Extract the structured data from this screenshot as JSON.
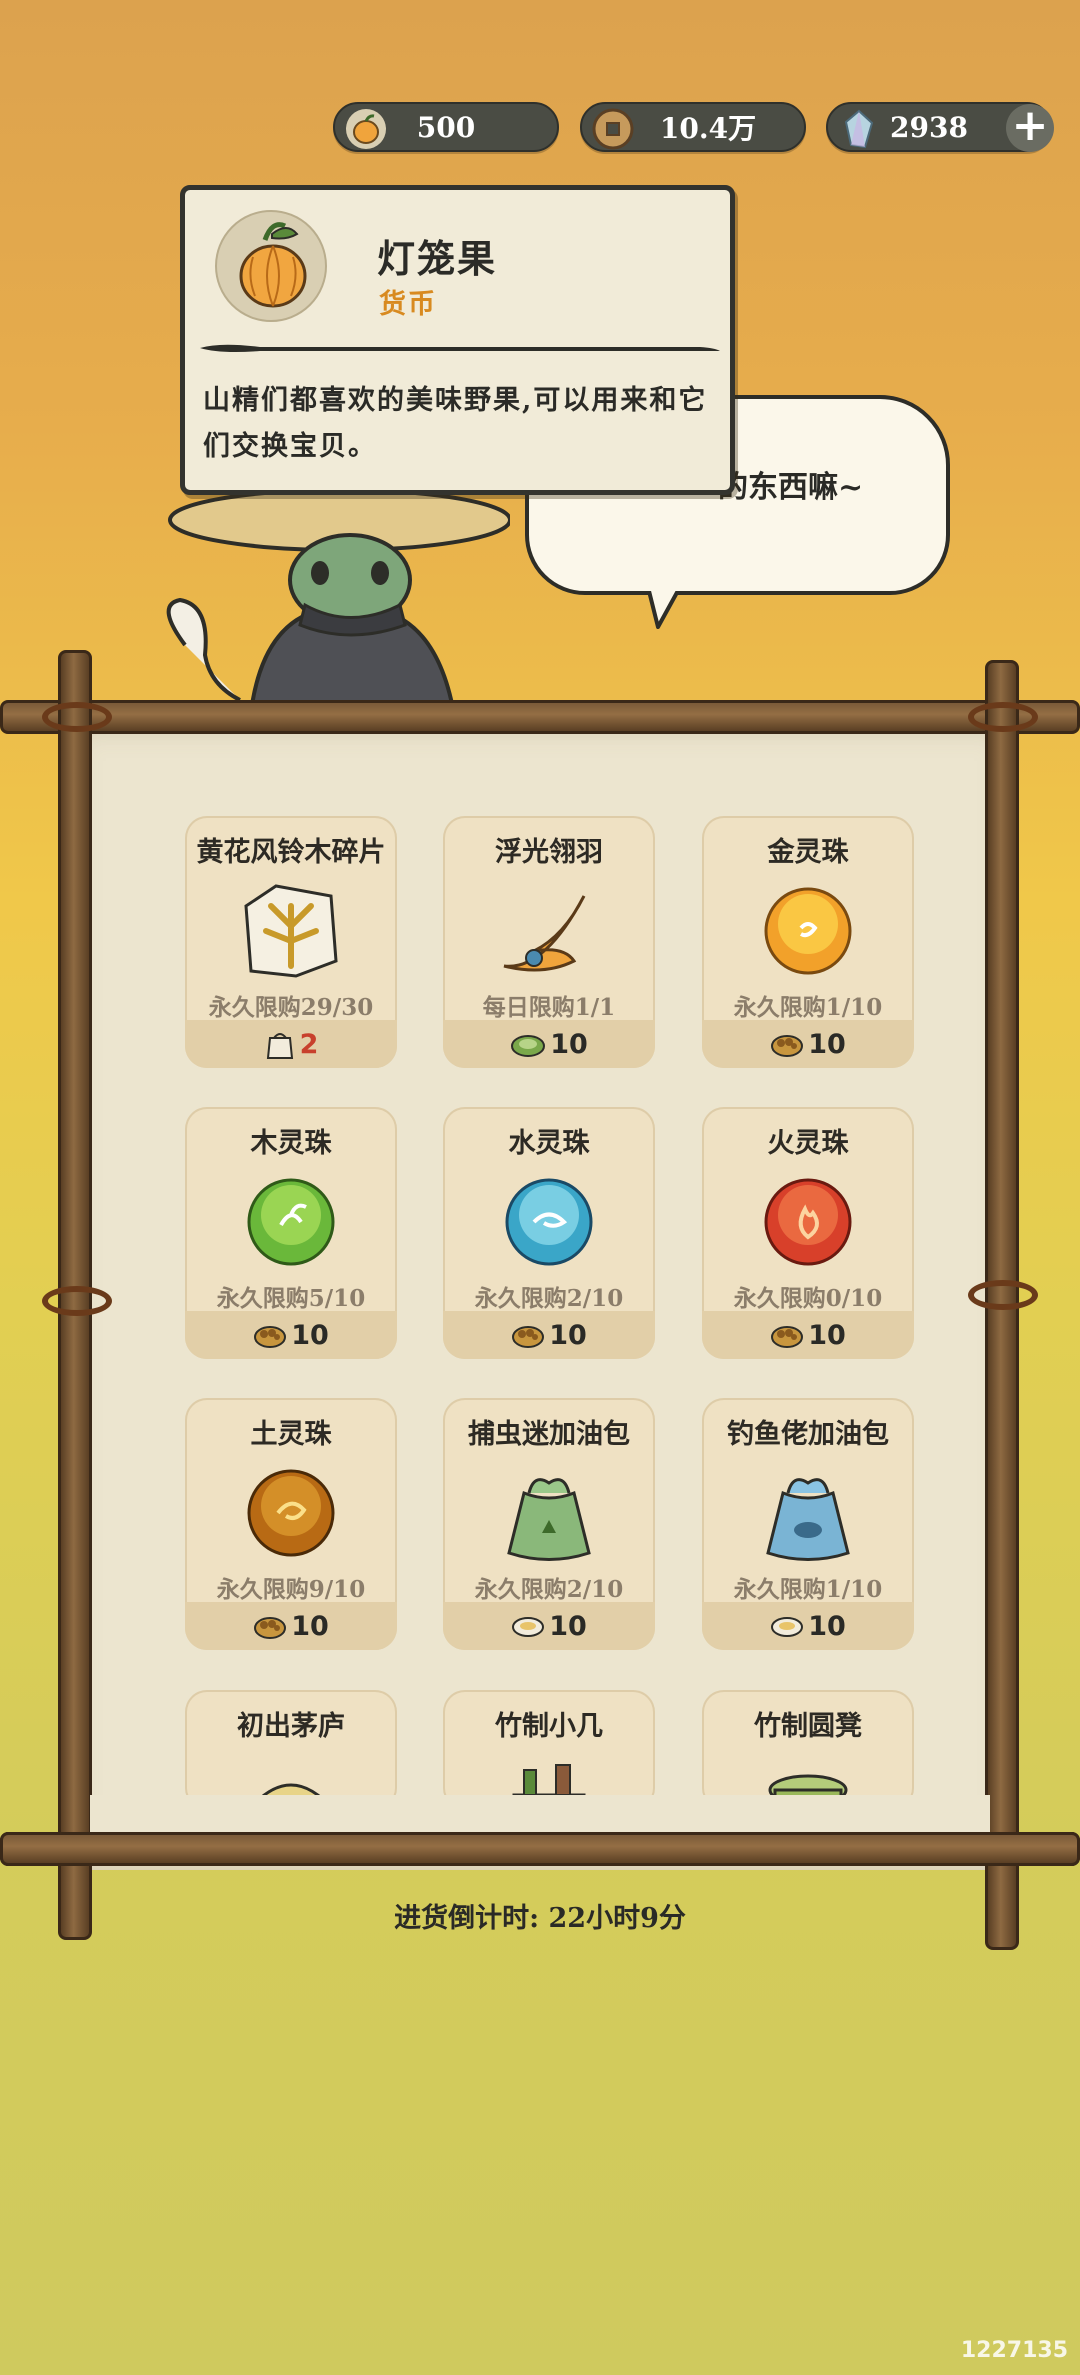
{
  "currencies": {
    "fruit": "500",
    "coins": "10.4万",
    "gems": "2938",
    "add": "+"
  },
  "speech": {
    "text": "的东西嘛~"
  },
  "tooltip": {
    "title": "灯笼果",
    "subtitle": "货币",
    "description": "山精们都喜欢的美味野果,可以用来和它们交换宝贝。"
  },
  "shop": {
    "items": [
      {
        "name": "黄花风铃木碎片",
        "limit": "永久限购29/30",
        "price": "2",
        "price_icon": "sack-icon"
      },
      {
        "name": "浮光翎羽",
        "limit": "每日限购1/1",
        "price": "10",
        "price_icon": "leaf-bundle-icon"
      },
      {
        "name": "金灵珠",
        "limit": "永久限购1/10",
        "price": "10",
        "price_icon": "nut-basket-icon"
      },
      {
        "name": "木灵珠",
        "limit": "永久限购5/10",
        "price": "10",
        "price_icon": "nut-basket-icon"
      },
      {
        "name": "水灵珠",
        "limit": "永久限购2/10",
        "price": "10",
        "price_icon": "nut-basket-icon"
      },
      {
        "name": "火灵珠",
        "limit": "永久限购0/10",
        "price": "10",
        "price_icon": "nut-basket-icon"
      },
      {
        "name": "土灵珠",
        "limit": "永久限购9/10",
        "price": "10",
        "price_icon": "nut-basket-icon"
      },
      {
        "name": "捕虫迷加油包",
        "limit": "永久限购2/10",
        "price": "10",
        "price_icon": "plate-icon"
      },
      {
        "name": "钓鱼佬加油包",
        "limit": "永久限购1/10",
        "price": "10",
        "price_icon": "plate-icon"
      },
      {
        "name": "初出茅庐",
        "limit": "",
        "price": "",
        "price_icon": ""
      },
      {
        "name": "竹制小几",
        "limit": "",
        "price": "",
        "price_icon": ""
      },
      {
        "name": "竹制圆凳",
        "limit": "",
        "price": "",
        "price_icon": ""
      }
    ]
  },
  "countdown": "进货倒计时: 22小时9分",
  "watermark": "1227135",
  "colors": {
    "limit_text": "#8b7d6a",
    "price_red": "#c8402c",
    "subtitle_orange": "#d88a20"
  }
}
